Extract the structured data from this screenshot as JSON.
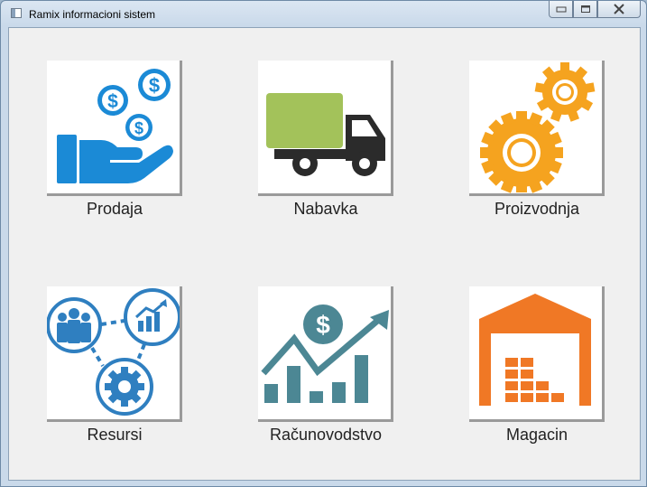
{
  "window": {
    "title": "Ramix informacioni sistem",
    "controls": {
      "minimize_icon": "minimize-icon",
      "maximize_icon": "maximize-icon",
      "close_icon": "close-icon"
    }
  },
  "tiles": [
    {
      "label": "Prodaja",
      "icon": "hand-money-icon",
      "color": "#1b8ad6"
    },
    {
      "label": "Nabavka",
      "icon": "truck-icon",
      "color": "#a3c25a"
    },
    {
      "label": "Proizvodnja",
      "icon": "gears-icon",
      "color": "#f5a31f"
    },
    {
      "label": "Resursi",
      "icon": "people-growth-gear-icon",
      "color": "#2f7fc0"
    },
    {
      "label": "Računovodstvo",
      "icon": "accounting-chart-icon",
      "color": "#4c8794"
    },
    {
      "label": "Magacin",
      "icon": "warehouse-icon",
      "color": "#f07825"
    }
  ]
}
